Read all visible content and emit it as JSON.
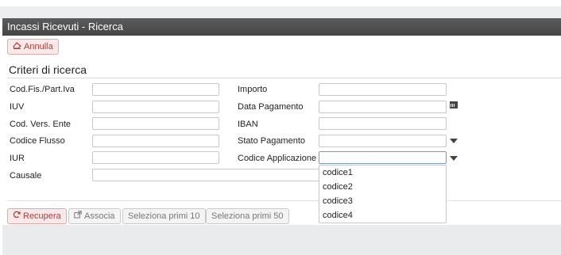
{
  "window": {
    "title": "Incassi Ricevuti - Ricerca"
  },
  "toolbar": {
    "cancel_label": "Annulla"
  },
  "criteria": {
    "title": "Criteri di ricerca",
    "left": [
      {
        "label": "Cod.Fis./Part.Iva",
        "value": ""
      },
      {
        "label": "IUV",
        "value": ""
      },
      {
        "label": "Cod. Vers. Ente",
        "value": ""
      },
      {
        "label": "Codice Flusso",
        "value": ""
      },
      {
        "label": "IUR",
        "value": ""
      },
      {
        "label": "Causale",
        "value": ""
      }
    ],
    "right": [
      {
        "label": "Importo",
        "value": ""
      },
      {
        "label": "Data Pagamento",
        "value": ""
      },
      {
        "label": "IBAN",
        "value": ""
      },
      {
        "label": "Stato Pagamento",
        "value": ""
      },
      {
        "label": "Codice Applicazione",
        "value": ""
      }
    ]
  },
  "dropdown": {
    "options": [
      "codice1",
      "codice2",
      "codice3",
      "codice4"
    ]
  },
  "actions": {
    "recupera": "Recupera",
    "associa": "Associa",
    "primi10": "Seleziona primi 10",
    "primi50": "Seleziona primi 50"
  },
  "icons": {
    "cancel": "eraser-icon",
    "recupera": "refresh-icon",
    "associa": "external-link-icon",
    "calendar": "calendar-icon",
    "select": "caret-down-icon"
  },
  "colors": {
    "header": "#4f4f4f",
    "accent_red": "#b33a3a",
    "focus_border": "#6f9bd4"
  }
}
